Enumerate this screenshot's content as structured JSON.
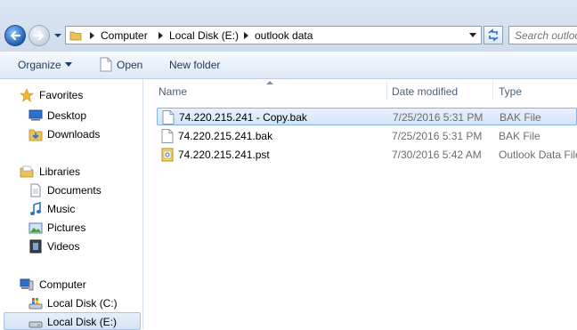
{
  "address": {
    "breadcrumbs": [
      "Computer",
      "Local Disk (E:)",
      "outlook data"
    ],
    "search_placeholder": "Search outlook data"
  },
  "toolbar": {
    "organize_label": "Organize",
    "open_label": "Open",
    "new_folder_label": "New folder"
  },
  "nav": {
    "favorites": "Favorites",
    "desktop": "Desktop",
    "downloads": "Downloads",
    "libraries": "Libraries",
    "documents": "Documents",
    "music": "Music",
    "pictures": "Pictures",
    "videos": "Videos",
    "computer": "Computer",
    "local_c": "Local Disk (C:)",
    "local_e": "Local Disk (E:)"
  },
  "columns": {
    "name": "Name",
    "date_modified": "Date modified",
    "type": "Type"
  },
  "files": [
    {
      "name": "74.220.215.241 - Copy.bak",
      "date": "7/25/2016 5:31 PM",
      "type": "BAK File",
      "selected": true
    },
    {
      "name": "74.220.215.241.bak",
      "date": "7/25/2016 5:31 PM",
      "type": "BAK File",
      "selected": false
    },
    {
      "name": "74.220.215.241.pst",
      "date": "7/30/2016 5:42 AM",
      "type": "Outlook Data File",
      "selected": false
    }
  ],
  "colors": {
    "selection_border": "#86b3e7",
    "link_text": "#1e395b"
  }
}
